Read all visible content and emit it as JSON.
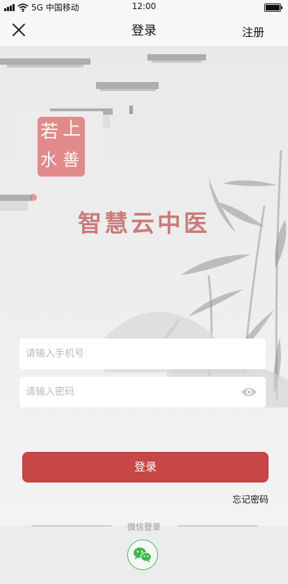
{
  "status_bar": {
    "carrier": "5G 中国移动",
    "time": "12:00"
  },
  "nav": {
    "title": "登录",
    "register_label": "注册"
  },
  "logo": {
    "text": "上善若水"
  },
  "app_title": "智慧云中医",
  "form": {
    "phone_placeholder": "请输入手机号",
    "password_placeholder": "请输入密码",
    "login_label": "登录",
    "forgot_label": "忘记密码"
  },
  "footer": {
    "wechat_label": "微信登录"
  },
  "colors": {
    "primary": "#c74646",
    "title": "#c97b7b",
    "wechat": "#3fb84a"
  },
  "icons": [
    "close-icon",
    "eye-icon",
    "wechat-icon",
    "signal-icon",
    "wifi-icon",
    "battery-icon"
  ]
}
